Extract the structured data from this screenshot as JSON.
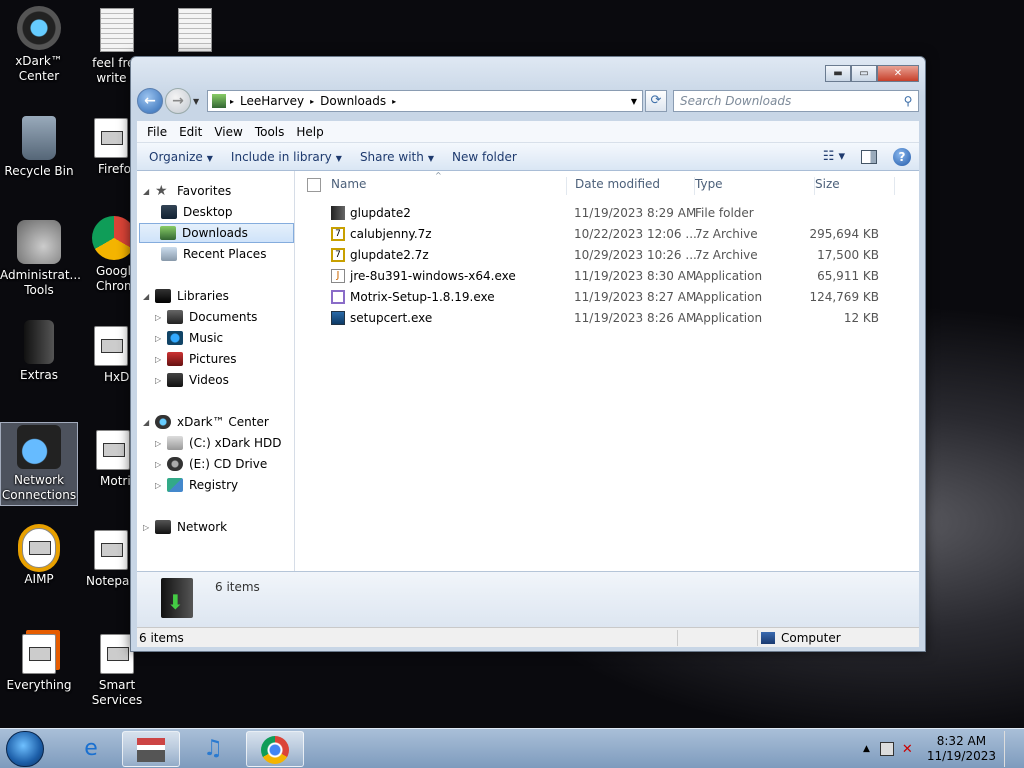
{
  "desktop": {
    "icons": [
      {
        "label": "xDark™ Center"
      },
      {
        "label": "feel free write a"
      },
      {
        "label": ""
      },
      {
        "label": "Recycle Bin"
      },
      {
        "label": "Firefo"
      },
      {
        "label": "Administrat... Tools"
      },
      {
        "label": "Googl Chrom"
      },
      {
        "label": "Extras"
      },
      {
        "label": "HxD"
      },
      {
        "label": "Network Connections"
      },
      {
        "label": "Motri"
      },
      {
        "label": "AIMP"
      },
      {
        "label": "Notepa"
      },
      {
        "label": "Everything"
      },
      {
        "label": "Smart Services"
      }
    ]
  },
  "window": {
    "buttons": {
      "minimize": "▬",
      "maximize": "▭",
      "close": "✕"
    },
    "address": {
      "root_arrow": "▸",
      "path": [
        "LeeHarvey",
        "Downloads"
      ]
    },
    "search_placeholder": "Search Downloads",
    "menu": [
      "File",
      "Edit",
      "View",
      "Tools",
      "Help"
    ],
    "commands": [
      "Organize",
      "Include in library",
      "Share with",
      "New folder"
    ],
    "nav": {
      "favorites": {
        "label": "Favorites",
        "items": [
          "Desktop",
          "Downloads",
          "Recent Places"
        ]
      },
      "libraries": {
        "label": "Libraries",
        "items": [
          "Documents",
          "Music",
          "Pictures",
          "Videos"
        ]
      },
      "computer": {
        "label": "xDark™ Center",
        "items": [
          "(C:) xDark HDD",
          "(E:) CD Drive",
          "Registry"
        ]
      },
      "network": {
        "label": "Network"
      }
    },
    "columns": [
      "Name",
      "Date modified",
      "Type",
      "Size"
    ],
    "files": [
      {
        "name": "glupdate2",
        "date": "11/19/2023 8:29 AM",
        "type": "File folder",
        "size": "",
        "icon": "folder-icon"
      },
      {
        "name": "calubjenny.7z",
        "date": "10/22/2023 12:06 ...",
        "type": "7z Archive",
        "size": "295,694 KB",
        "icon": "archive-icon"
      },
      {
        "name": "glupdate2.7z",
        "date": "10/29/2023 10:26 ...",
        "type": "7z Archive",
        "size": "17,500 KB",
        "icon": "archive-icon"
      },
      {
        "name": "jre-8u391-windows-x64.exe",
        "date": "11/19/2023 8:30 AM",
        "type": "Application",
        "size": "65,911 KB",
        "icon": "java-icon"
      },
      {
        "name": "Motrix-Setup-1.8.19.exe",
        "date": "11/19/2023 8:27 AM",
        "type": "Application",
        "size": "124,769 KB",
        "icon": "installer-icon"
      },
      {
        "name": "setupcert.exe",
        "date": "11/19/2023 8:26 AM",
        "type": "Application",
        "size": "12 KB",
        "icon": "app-icon"
      }
    ],
    "details_count": "6 items",
    "status_count": "6 items",
    "status_location": "Computer"
  },
  "taskbar": {
    "time": "8:32 AM",
    "date": "11/19/2023"
  }
}
